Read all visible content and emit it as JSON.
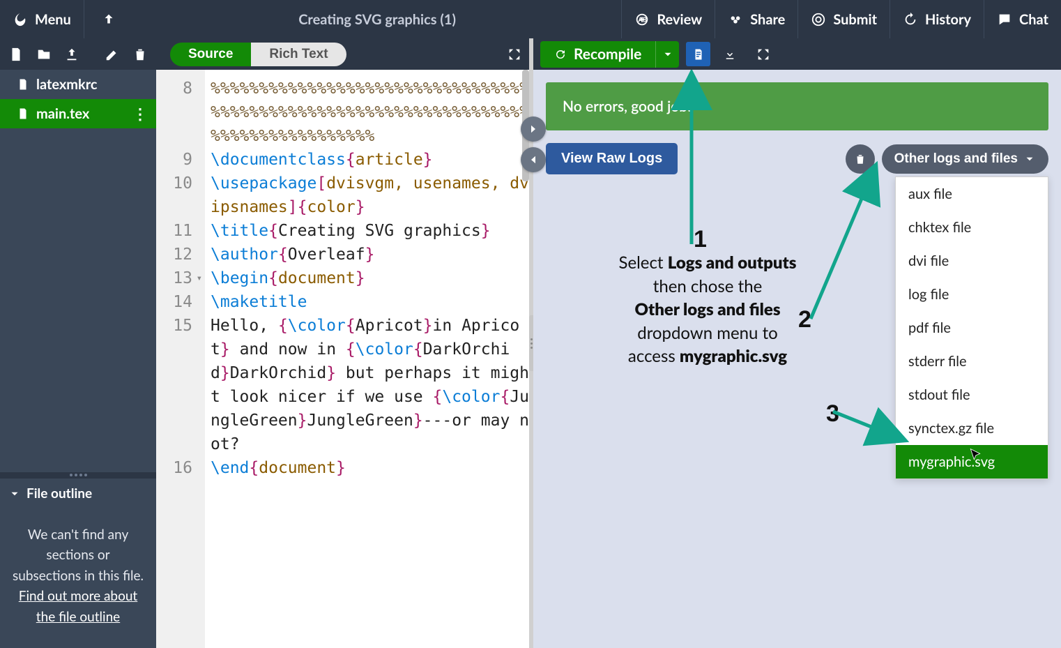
{
  "topbar": {
    "menu_label": "Menu",
    "title": "Creating SVG graphics (1)",
    "review_label": "Review",
    "share_label": "Share",
    "submit_label": "Submit",
    "history_label": "History",
    "chat_label": "Chat"
  },
  "files": {
    "items": [
      {
        "name": "latexmkrc",
        "icon": "file-icon",
        "active": false
      },
      {
        "name": "main.tex",
        "icon": "file-icon",
        "active": true
      }
    ]
  },
  "outline": {
    "header": "File outline",
    "body_line1": "We can't find any sections or subsections in this file.",
    "link_text": "Find out more about the file outline"
  },
  "editor": {
    "tabs": {
      "source": "Source",
      "rich": "Rich Text"
    },
    "lines": [
      {
        "n": 8,
        "segs": [
          {
            "t": "%%%%%%%%%%%%%%%%%%%%%%%%%%%%%%%%%%%%%%%%%%%%%%%%%%%%%%%%%%%%%%%%%%%%%%%%%%%%%%%%%%%",
            "c": "tok-pct"
          }
        ]
      },
      {
        "n": 9,
        "segs": [
          {
            "t": "\\documentclass",
            "c": "tok-cmd"
          },
          {
            "t": "{",
            "c": "tok-brace"
          },
          {
            "t": "article",
            "c": "tok-arg"
          },
          {
            "t": "}",
            "c": "tok-brace"
          }
        ]
      },
      {
        "n": 10,
        "segs": [
          {
            "t": "\\usepackage",
            "c": "tok-cmd"
          },
          {
            "t": "[",
            "c": "tok-brace"
          },
          {
            "t": "dvisvgm, usenames, dvipsnames",
            "c": "tok-arg"
          },
          {
            "t": "]",
            "c": "tok-brace"
          },
          {
            "t": "{",
            "c": "tok-brace"
          },
          {
            "t": "color",
            "c": "tok-arg"
          },
          {
            "t": "}",
            "c": "tok-brace"
          }
        ]
      },
      {
        "n": 11,
        "segs": [
          {
            "t": "\\title",
            "c": "tok-cmd"
          },
          {
            "t": "{",
            "c": "tok-brace"
          },
          {
            "t": "Creating SVG graphics",
            "c": ""
          },
          {
            "t": "}",
            "c": "tok-brace"
          }
        ]
      },
      {
        "n": 12,
        "segs": [
          {
            "t": "\\author",
            "c": "tok-cmd"
          },
          {
            "t": "{",
            "c": "tok-brace"
          },
          {
            "t": "Overleaf",
            "c": ""
          },
          {
            "t": "}",
            "c": "tok-brace"
          }
        ]
      },
      {
        "n": 13,
        "fold": true,
        "segs": [
          {
            "t": "\\begin",
            "c": "tok-cmd"
          },
          {
            "t": "{",
            "c": "tok-brace"
          },
          {
            "t": "document",
            "c": "tok-arg"
          },
          {
            "t": "}",
            "c": "tok-brace"
          }
        ]
      },
      {
        "n": 14,
        "segs": [
          {
            "t": "\\maketitle",
            "c": "tok-cmd"
          }
        ]
      },
      {
        "n": 15,
        "segs": [
          {
            "t": "Hello, ",
            "c": ""
          },
          {
            "t": "{",
            "c": "tok-brace"
          },
          {
            "t": "\\color",
            "c": "tok-cmd"
          },
          {
            "t": "{",
            "c": "tok-brace"
          },
          {
            "t": "Apricot",
            "c": ""
          },
          {
            "t": "}",
            "c": "tok-brace"
          },
          {
            "t": "in Apricot",
            "c": ""
          },
          {
            "t": "}",
            "c": "tok-brace"
          },
          {
            "t": " and now in ",
            "c": ""
          },
          {
            "t": "{",
            "c": "tok-brace"
          },
          {
            "t": "\\color",
            "c": "tok-cmd"
          },
          {
            "t": "{",
            "c": "tok-brace"
          },
          {
            "t": "DarkOrchid",
            "c": ""
          },
          {
            "t": "}",
            "c": "tok-brace"
          },
          {
            "t": "DarkOrchid",
            "c": ""
          },
          {
            "t": "}",
            "c": "tok-brace"
          },
          {
            "t": " but perhaps it might look nicer if we use ",
            "c": ""
          },
          {
            "t": "{",
            "c": "tok-brace"
          },
          {
            "t": "\\color",
            "c": "tok-cmd"
          },
          {
            "t": "{",
            "c": "tok-brace"
          },
          {
            "t": "JungleGreen",
            "c": ""
          },
          {
            "t": "}",
            "c": "tok-brace"
          },
          {
            "t": "JungleGreen",
            "c": ""
          },
          {
            "t": "}",
            "c": "tok-brace"
          },
          {
            "t": "---or may not?",
            "c": ""
          }
        ]
      },
      {
        "n": 16,
        "segs": [
          {
            "t": "\\end",
            "c": "tok-cmd"
          },
          {
            "t": "{",
            "c": "tok-brace"
          },
          {
            "t": "document",
            "c": "tok-arg"
          },
          {
            "t": "}",
            "c": "tok-brace"
          }
        ]
      }
    ]
  },
  "preview": {
    "recompile_label": "Recompile",
    "no_errors": "No errors, good job!",
    "view_raw_logs": "View Raw Logs",
    "other_logs_label": "Other logs and files",
    "dropdown_items": [
      {
        "label": "aux file",
        "hi": false
      },
      {
        "label": "chktex file",
        "hi": false
      },
      {
        "label": "dvi file",
        "hi": false
      },
      {
        "label": "log file",
        "hi": false
      },
      {
        "label": "pdf file",
        "hi": false
      },
      {
        "label": "stderr file",
        "hi": false
      },
      {
        "label": "stdout file",
        "hi": false
      },
      {
        "label": "synctex.gz file",
        "hi": false
      },
      {
        "label": "mygraphic.svg",
        "hi": true
      }
    ]
  },
  "annotation": {
    "line1_a": "Select ",
    "line1_b": "Logs and outputs",
    "line2": "then chose the",
    "line3": "Other logs and files",
    "line4": "dropdown menu to",
    "line5_a": "access ",
    "line5_b": "mygraphic.svg",
    "num1": "1",
    "num2": "2",
    "num3": "3"
  }
}
